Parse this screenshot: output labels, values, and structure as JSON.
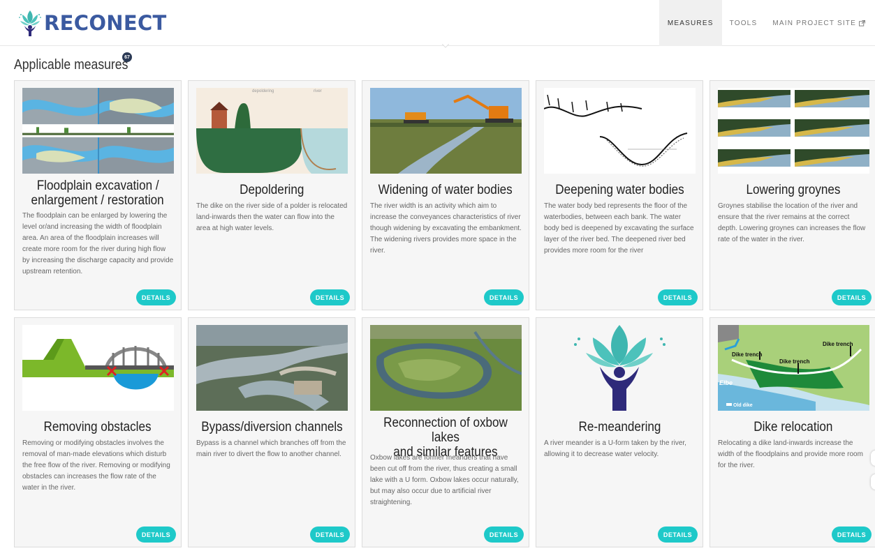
{
  "brand": {
    "name": "RECONECT"
  },
  "nav": [
    {
      "label": "MEASURES",
      "active": true
    },
    {
      "label": "TOOLS",
      "active": false
    },
    {
      "label": "MAIN PROJECT SITE",
      "active": false,
      "external_icon": "external-link-icon"
    }
  ],
  "section": {
    "title": "Applicable measures",
    "count": "67"
  },
  "details_label": "DETAILS",
  "cards": [
    {
      "title_lines": [
        "Floodplain excavation /",
        "enlargement / restoration"
      ],
      "description": "The floodplain can be enlarged by lowering the level or/and increasing the width of floodplain area. An area of the floodplain increases will create more room for the river during high flow by increasing the discharge capacity and provide upstream retention."
    },
    {
      "title_lines": [
        "Depoldering"
      ],
      "description": "The dike on the river side of a polder is relocated land-inwards then the water can flow into the area at high water levels.",
      "image_labels": [
        "depoldering",
        "river"
      ]
    },
    {
      "title_lines": [
        "Widening of water bodies"
      ],
      "description": "The river width is an activity which aim to increase the conveyances characteristics of river though widening by excavating the embankment. The widening rivers provides more space in the river."
    },
    {
      "title_lines": [
        "Deepening water bodies"
      ],
      "description": "The water body bed represents the floor of the waterbodies, between each bank. The water body bed is deepened by excavating the surface layer of the river bed. The deepened river bed provides more room for the river"
    },
    {
      "title_lines": [
        "Lowering groynes"
      ],
      "description": "Groynes stabilise the location of the river and ensure that the river remains at the correct depth. Lowering groynes can increases the flow rate of the water in the river."
    },
    {
      "title_lines": [
        "Removing obstacles"
      ],
      "description": "Removing or modifying obstacles involves the removal of man-made elevations which disturb the free flow of the river. Removing or modifying obstacles can increases the flow rate of the water in the river."
    },
    {
      "title_lines": [
        "Bypass/diversion channels"
      ],
      "description": "Bypass is a channel which branches off from the main river to divert the flow to another channel."
    },
    {
      "title_lines": [
        "Reconnection of oxbow lakes",
        "and similar features"
      ],
      "description": "Oxbow lakes are former meanders that have been cut off from the river, thus creating a small lake with a U form. Oxbow lakes occur naturally, but may also occur due to artificial river straightening."
    },
    {
      "title_lines": [
        "Re-meandering"
      ],
      "description": "A river meander is a U-form taken by the river, allowing it to decrease water velocity."
    },
    {
      "title_lines": [
        "Dike relocation"
      ],
      "description": "Relocating a dike land-inwards increase the width of the floodplains and provide more room for the river.",
      "image_labels": [
        "Dike trench",
        "Dike trench",
        "Dike trench",
        "Elbe",
        "Old dike"
      ]
    }
  ]
}
